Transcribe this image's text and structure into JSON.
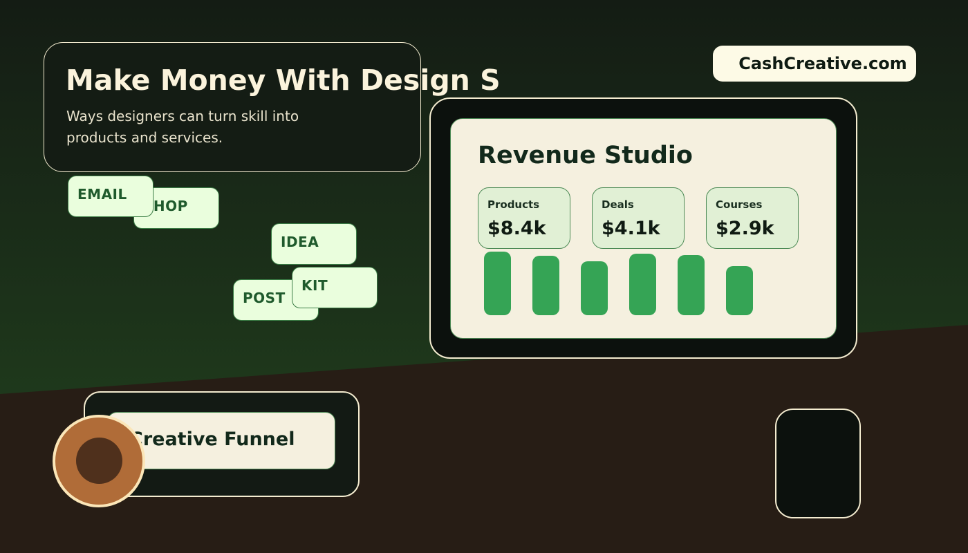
{
  "colors": {
    "background_top": "#141c14",
    "background_green": "#1f3a1c",
    "background_ground": "#271d15",
    "accent_green": "#35a455",
    "cream": "#f5f0df",
    "tag_fill": "#eafedd"
  },
  "header": {
    "title": "Make Money With Design S",
    "subtitle": "Ways designers can turn skill into products and services."
  },
  "brand": {
    "domain": "CashCreative.com"
  },
  "tags": [
    "EMAIL",
    "SHOP",
    "IDEA",
    "POST",
    "KIT"
  ],
  "dashboard": {
    "title": "Revenue Studio",
    "stats": [
      {
        "label": "Products",
        "value": "$8.4k"
      },
      {
        "label": "Deals",
        "value": "$4.1k"
      },
      {
        "label": "Courses",
        "value": "$2.9k"
      }
    ],
    "bar_levels": [
      1.0,
      0.93,
      0.85,
      0.97,
      0.95,
      0.77
    ]
  },
  "funnel": {
    "label": "Creative Funnel"
  },
  "icons": [
    "coin-icon",
    "phone-icon"
  ]
}
